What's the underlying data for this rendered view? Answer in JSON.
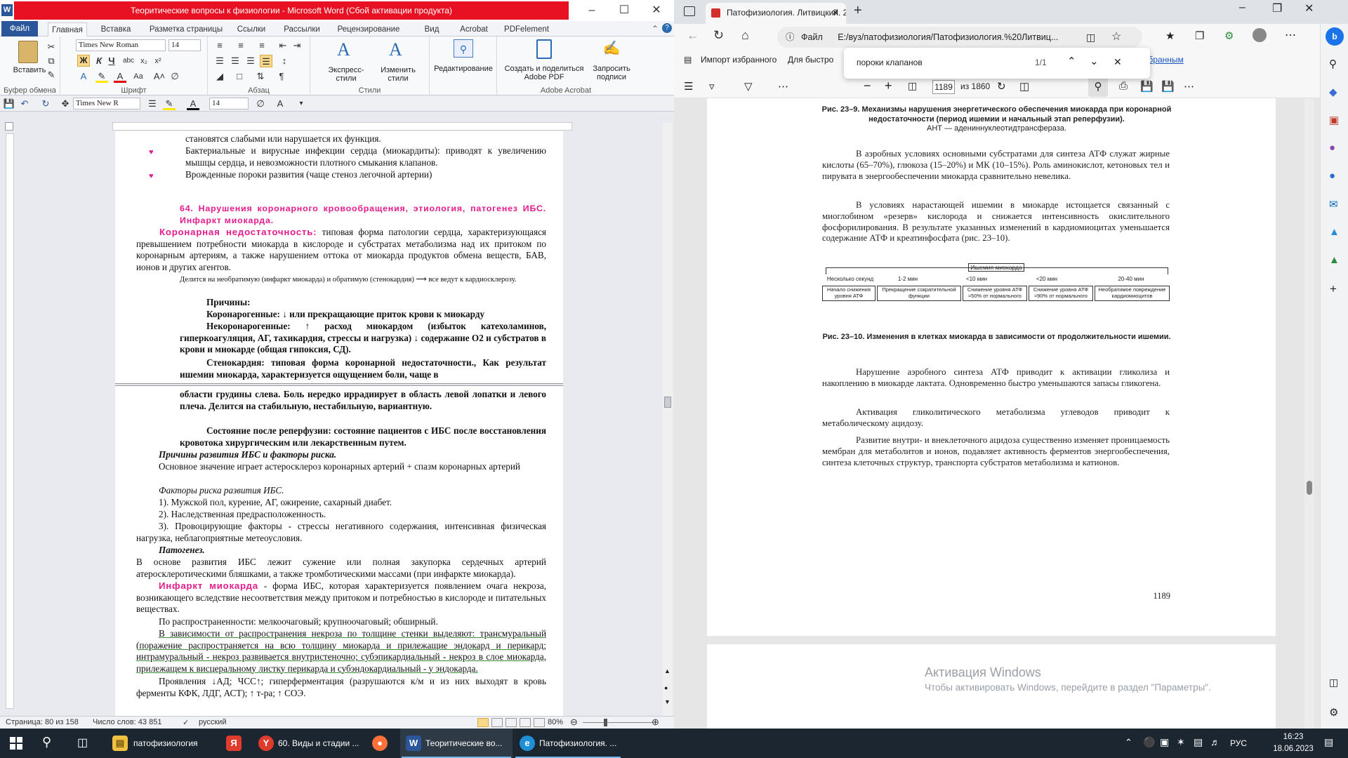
{
  "word": {
    "title": "Теоритические вопросы к физиологии - Microsoft Word (Сбой активации продукта)",
    "tabs": [
      "Файл",
      "Главная",
      "Вставка",
      "Разметка страницы",
      "Ссылки",
      "Рассылки",
      "Рецензирование",
      "Вид",
      "Acrobat",
      "PDFelement"
    ],
    "ribbon": {
      "paste": "Вставить",
      "clipboard": "Буфер обмена",
      "font_name": "Times New Roman",
      "font_size": "14",
      "font_group": "Шрифт",
      "paragraph_group": "Абзац",
      "styles_express": "Экспресс-стили",
      "styles_change": "Изменить стили",
      "styles_group": "Стили",
      "editing": "Редактирование",
      "create_share": "Создать и поделиться Adobe PDF",
      "request_sign": "Запросить подписи",
      "acrobat_group": "Adobe Acrobat"
    },
    "qat": {
      "font": "Times New R",
      "size": "14"
    },
    "doc": {
      "l1": "становятся слабыми или нарушается их функция.",
      "b1": "Бактериальные и вирусные инфекции сердца (миокардиты): приводят к увеличению мышцы сердца, и невозможности плотного смыкания клапанов.",
      "b2": "Врожденные пороки развития (чаще стеноз легочной артерии)",
      "h64": "64. Нарушения коронарного кровообращения, этиология, патогенез ИБС. Инфаркт миокарда.",
      "cor_term": "Коронарная недостаточность:",
      "cor_def": " типовая форма патологии сердца, характеризующаяся превышением потребности миокарда в кислороде и субстратах метаболизма над их притоком по коронарным артериям, а также нарушением оттока от миокарда продуктов обмена веществ, БАВ, ионов и других агентов.",
      "small": "Делится на необратимую (инфаркт миокарда) и обратимую (стенокардия) ⟶ все ведут к кардиосклерозу.",
      "causes": "Причины:",
      "coronarogenic": "Коронарогенные: ↓ или прекращающие приток крови к миокарду",
      "noncoronarogenic": "Некоронарогенные: ↑ расход миокардом (избыток катехоламинов, гиперкоагуляция, АГ, тахикардия, стрессы и нагрузка) ↓ содержание О2 и субстратов в крови и миокарде (общая гипоксия, СД).",
      "angina": "Стенокардия: типовая форма коронарной недостаточности., Как результат ишемии миокарда, характеризуется ощущением боли, чаще в",
      "angina2": "области грудины слева. Боль нередко иррадиирует в область левой лопатки и левого плеча. Делится на стабильную, нестабильную, вариантную.",
      "reperf": "Состояние после реперфузии: состояние пациентов с ИБС после восстановления кровотока хирургическим или лекарственным путем.",
      "causes_ibs": "Причины развития ИБС и факторы риска.",
      "main_val": "Основное значение играет астеросклероз коронарных артерий + спазм коронарных артерий",
      "risk": "Факторы риска развития ИБС.",
      "r1": "1). Мужской пол,  курение, АГ, ожирение, сахарный диабет.",
      "r2": "2). Наследственная предрасположенность.",
      "r3": "3). Провоцирующие факторы - стрессы негативного  содержания,  интенсивная физическая нагрузка, неблагоприятные метеоусловия.",
      "patho": "Патогенез.",
      "patho_text": "В основе развития ИБС лежит сужение или полная закупорка сердечных артерий атеросклеротическими бляшками, а также тромботическими массами (при инфаркте миокарда).",
      "mi_term": "Инфаркт миокарда",
      "mi_def": " - форма ИБС, которая характеризуется появлением очага некроза, возникающего вследствие несоответствия между притоком и потребностью в кислороде и питательных веществах.",
      "spread": "По распространенности: мелкоочаговый; крупноочаговый; обширный.",
      "depth": "В зависимости от распространения некроза по толщине стенки выделяют: трансмуральный (поражение распространяется на всю толщину миокарда и прилежащие эндокард и перикард;  интрамуральный - некроз развивается внутристеночно; субэпикардиальный - некроз в слое миокарда, прилежащем к висцеральному листку перикарда и субэндокардиальный - у эндокарда.",
      "manif": "Проявления ↓АД; ЧСС↑; гиперферментация (разрушаются к/м и из них выходят в кровь ферменты КФК, ЛДГ, АСТ); ↑ т-ра; ↑ СОЭ."
    },
    "status": {
      "page": "Страница: 80 из 158",
      "words": "Число слов: 43 851",
      "lang": "русский",
      "zoom": "80%"
    }
  },
  "edge": {
    "tab_title": "Патофизиология. Литвицкий. 2",
    "url_label": "Файл",
    "url": "E:/вуз/патофизиология/Патофизиология.%20Литвиц...",
    "fav1": "Импорт избранного",
    "fav2": "Для быстро",
    "fav3": "ние избранным",
    "find": {
      "query": "пороки клапанов",
      "count": "1/1"
    },
    "pdf": {
      "page": "1189",
      "of": "из 1860"
    },
    "cap1a": "Рис. 23–9. Механизмы нарушения энергетического обеспечения миокарда при коронарной недостаточности (период ишемии и начальный этап реперфузии).",
    "cap1b": "АНТ — адениннуклеотидтрансфераза.",
    "p1": "В аэробных условиях основными субстратами для синтеза АТФ служат жирные кислоты (65–70%), глюкоза (15–20%) и МК (10–15%). Роль аминокислот, кетоновых тел и пирувата в энергообеспечении миокарда сравнительно невелика.",
    "p2": "В условиях нарастающей ишемии в миокарде истощается связанный с миоглобином «резерв» кислорода и снижается интенсивность окислительного фосфорилирования. В результате указанных изменений в кардиомиоцитах уменьшается содержание АТФ и креатинфосфата (рис. 23–10).",
    "diagram": {
      "title": "Ишемия миокарда",
      "times": [
        "Несколько секунд",
        "1-2 мин",
        "<10 мин",
        "<20 мин",
        "20-40 мин"
      ],
      "boxes": [
        "Начало снижения уровня АТФ",
        "Прекращение сократительной функции",
        "Снижение уровня АТФ ≈50% от нормального",
        "Снижение уровня АТФ ≈90% от нормального",
        "Необратимое повреждение кардиомиоцитов"
      ]
    },
    "cap2": "Рис. 23–10. Изменения в клетках миокарда в зависимости от продолжительности ишемии.",
    "p3": "Нарушение аэробного синтеза АТФ приводит к активации гликолиза и накоплению в миокарде лактата. Одновременно быстро уменьшаются запасы гликогена.",
    "p4": "Активация гликолитического метаболизма углеводов приводит к метаболическому ацидозу.",
    "p5": "Развитие внутри- и внеклеточного ацидоза существенно изменяет проницаемость мембран для метаболитов и ионов, подавляет активность ферментов энергообеспечения, синтеза клеточных структур, транспорта субстратов метаболизма и катионов.",
    "page_num": "1189",
    "activation1": "Активация Windows",
    "activation2": "Чтобы активировать Windows, перейдите в раздел \"Параметры\"."
  },
  "taskbar": {
    "items": [
      "патофизиология",
      "60. Виды и стадии ...",
      "Теоритические во...",
      "Патофизиология. ..."
    ],
    "lang": "РУС",
    "time": "16:23",
    "date": "18.06.2023"
  }
}
